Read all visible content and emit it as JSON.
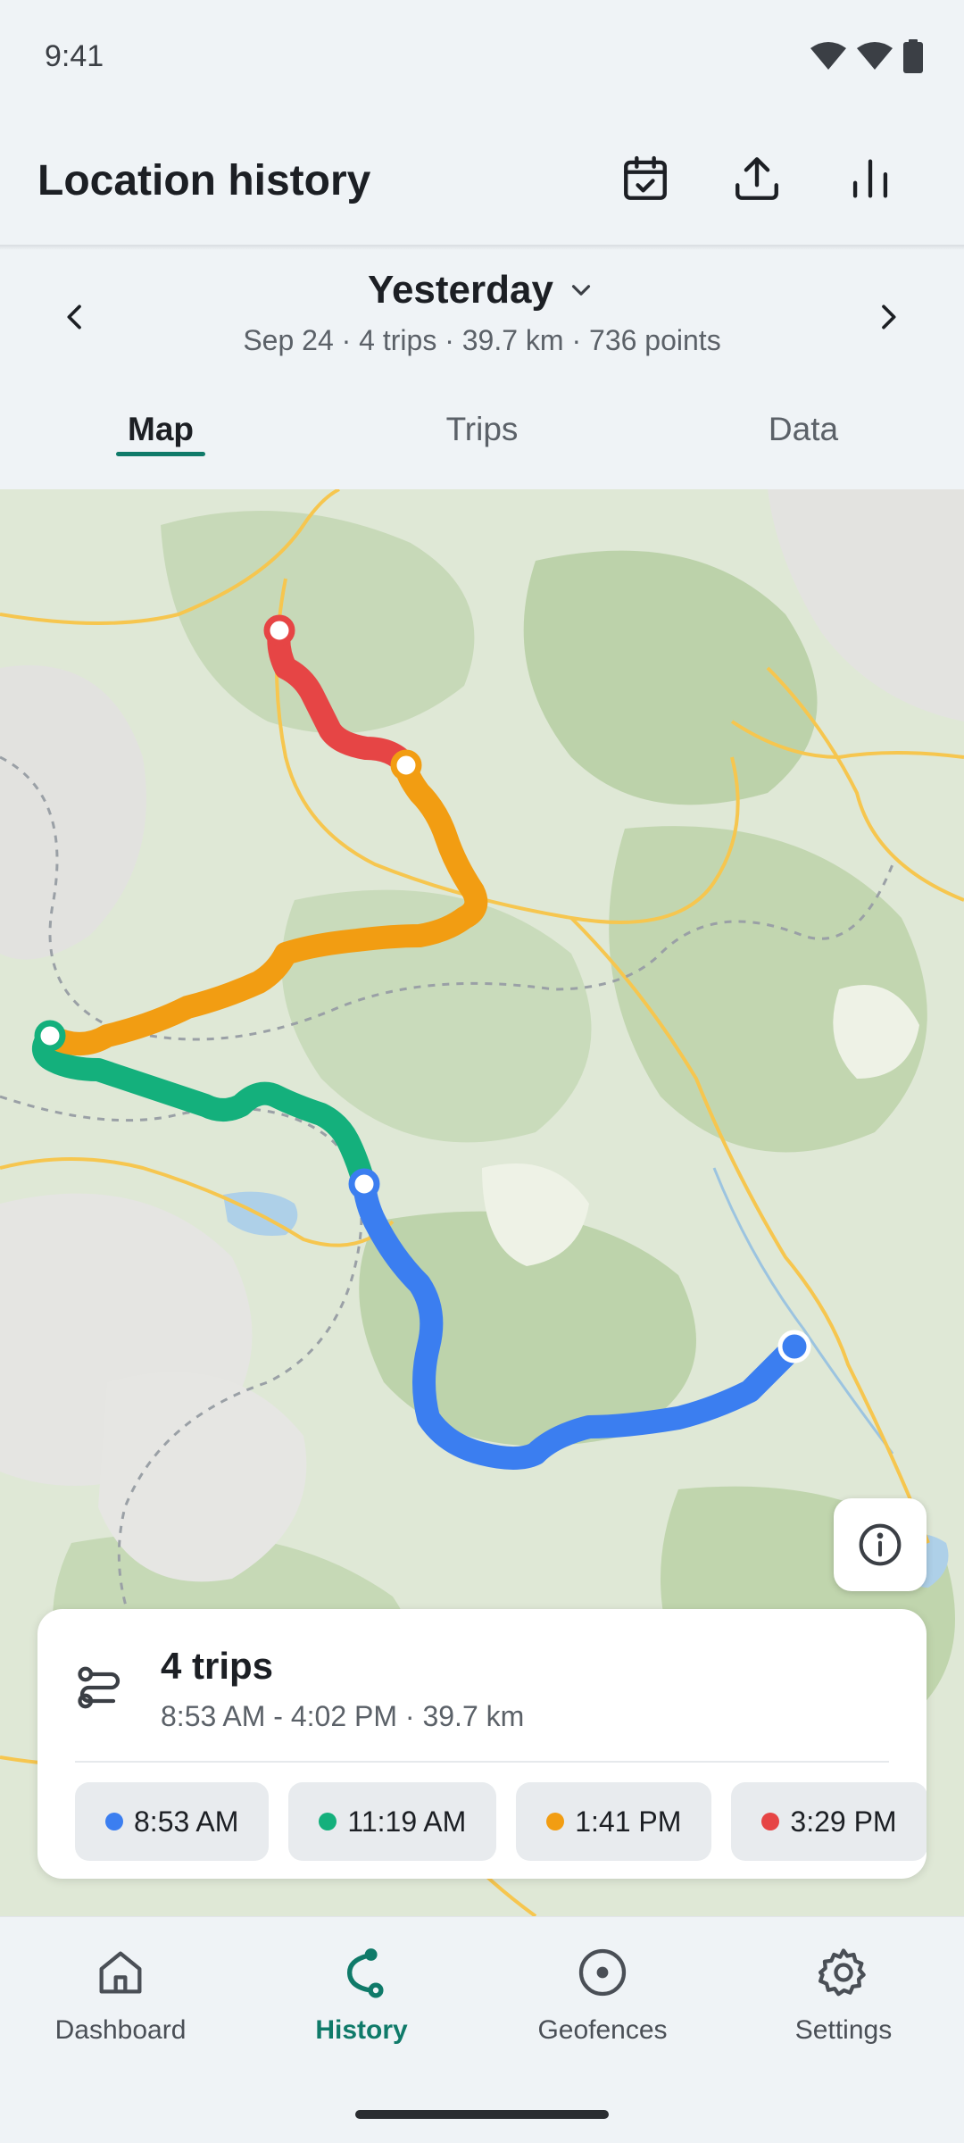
{
  "status_bar": {
    "time": "9:41",
    "icons": [
      "wifi-icon",
      "signal-icon",
      "battery-icon"
    ]
  },
  "app_bar": {
    "title": "Location history",
    "actions": [
      {
        "name": "calendar-check-icon",
        "label": "Select date"
      },
      {
        "name": "upload-icon",
        "label": "Export"
      },
      {
        "name": "bar-chart-icon",
        "label": "Statistics"
      }
    ]
  },
  "date_nav": {
    "title": "Yesterday",
    "summary": "Sep 24 · 4 trips · 39.7 km · 736 points",
    "prev_icon": "chevron-left-icon",
    "next_icon": "chevron-right-icon",
    "dropdown_icon": "chevron-down-icon"
  },
  "tabs": [
    {
      "label": "Map",
      "active": true
    },
    {
      "label": "Trips",
      "active": false
    },
    {
      "label": "Data",
      "active": false
    }
  ],
  "map": {
    "info_icon": "info-icon",
    "trip_colors": {
      "blue": "#3b7ef0",
      "green": "#14b07c",
      "orange": "#f29d12",
      "red": "#e64545"
    }
  },
  "trips_card": {
    "icon": "route-icon",
    "title": "4 trips",
    "subtitle": "8:53 AM - 4:02 PM · 39.7 km",
    "chips": [
      {
        "label": "8:53 AM",
        "color": "#3b7ef0"
      },
      {
        "label": "11:19 AM",
        "color": "#14b07c"
      },
      {
        "label": "1:41 PM",
        "color": "#f29d12"
      },
      {
        "label": "3:29 PM",
        "color": "#e64545"
      }
    ]
  },
  "bottom_nav": {
    "items": [
      {
        "label": "Dashboard",
        "icon": "home-icon",
        "active": false
      },
      {
        "label": "History",
        "icon": "history-route-icon",
        "active": true
      },
      {
        "label": "Geofences",
        "icon": "geofence-icon",
        "active": false
      },
      {
        "label": "Settings",
        "icon": "gear-icon",
        "active": false
      }
    ]
  },
  "colors": {
    "accent": "#0f7a69",
    "background": "#eff3f6"
  }
}
